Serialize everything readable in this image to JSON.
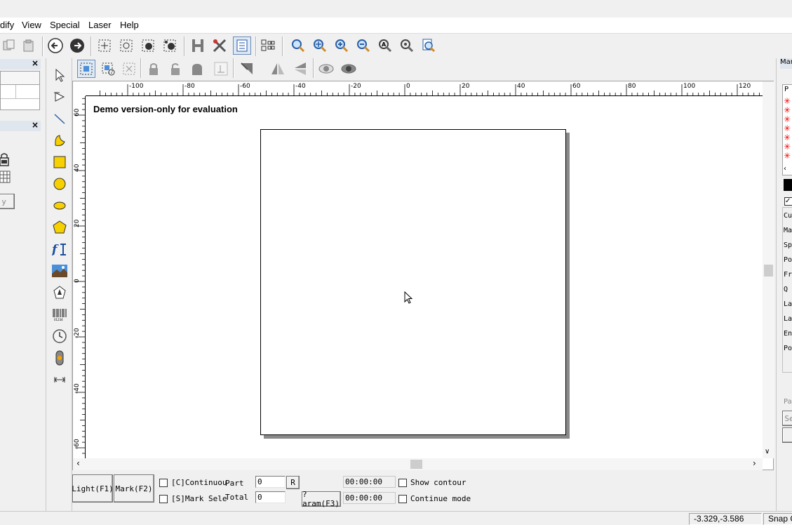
{
  "menu": {
    "items": [
      "dify",
      "View",
      "Special",
      "Laser",
      "Help"
    ]
  },
  "toolbar": {
    "icons": [
      "copy-icon",
      "paste-icon",
      "nav-back-icon",
      "nav-forward-icon",
      "node-select-icon",
      "node-edit-icon",
      "node-add-icon",
      "node-delete-icon",
      "hatch-icon",
      "tools-icon",
      "list-icon",
      "group-icon",
      "zoom-icon",
      "zoom-in-icon",
      "zoom-plus-icon",
      "zoom-minus-icon",
      "zoom-all-icon",
      "zoom-fit-icon",
      "zoom-page-icon"
    ]
  },
  "left_dock": {
    "button_label": "y"
  },
  "canvas": {
    "demo_text": "Demo version-only for evaluation",
    "hruler_labels": [
      ")",
      "-100",
      "-80",
      "-60",
      "-40",
      "-20",
      "0",
      "20",
      "40",
      "60",
      "80",
      "100",
      "120"
    ],
    "vruler_labels": [
      "60",
      "40",
      "20",
      "0",
      "-20",
      "-40",
      "-60"
    ]
  },
  "controls": {
    "light_button": "Light(F1)",
    "mark_button": "Mark(F2)",
    "continuous_label": "[C]Continuou",
    "mark_selected_label": "[S]Mark Sele",
    "part_label": "Part",
    "total_label": "Total",
    "part_value": "0",
    "total_value": "0",
    "r_button": "R",
    "param_button": "?aram(F3)",
    "time1": "00:00:00",
    "time2": "00:00:00",
    "show_contour_label": "Show contour",
    "continue_mode_label": "Continue mode"
  },
  "right_dock": {
    "title": "Mar",
    "header": "P",
    "rows": [
      "Cu",
      "Ma",
      "Sp",
      "Po",
      "Fr",
      "Q",
      "La",
      "La",
      "En",
      "Po"
    ],
    "footer": [
      "Par",
      "Se"
    ]
  },
  "status": {
    "coords": "-3.329,-3.586",
    "snap": "Snap G"
  }
}
